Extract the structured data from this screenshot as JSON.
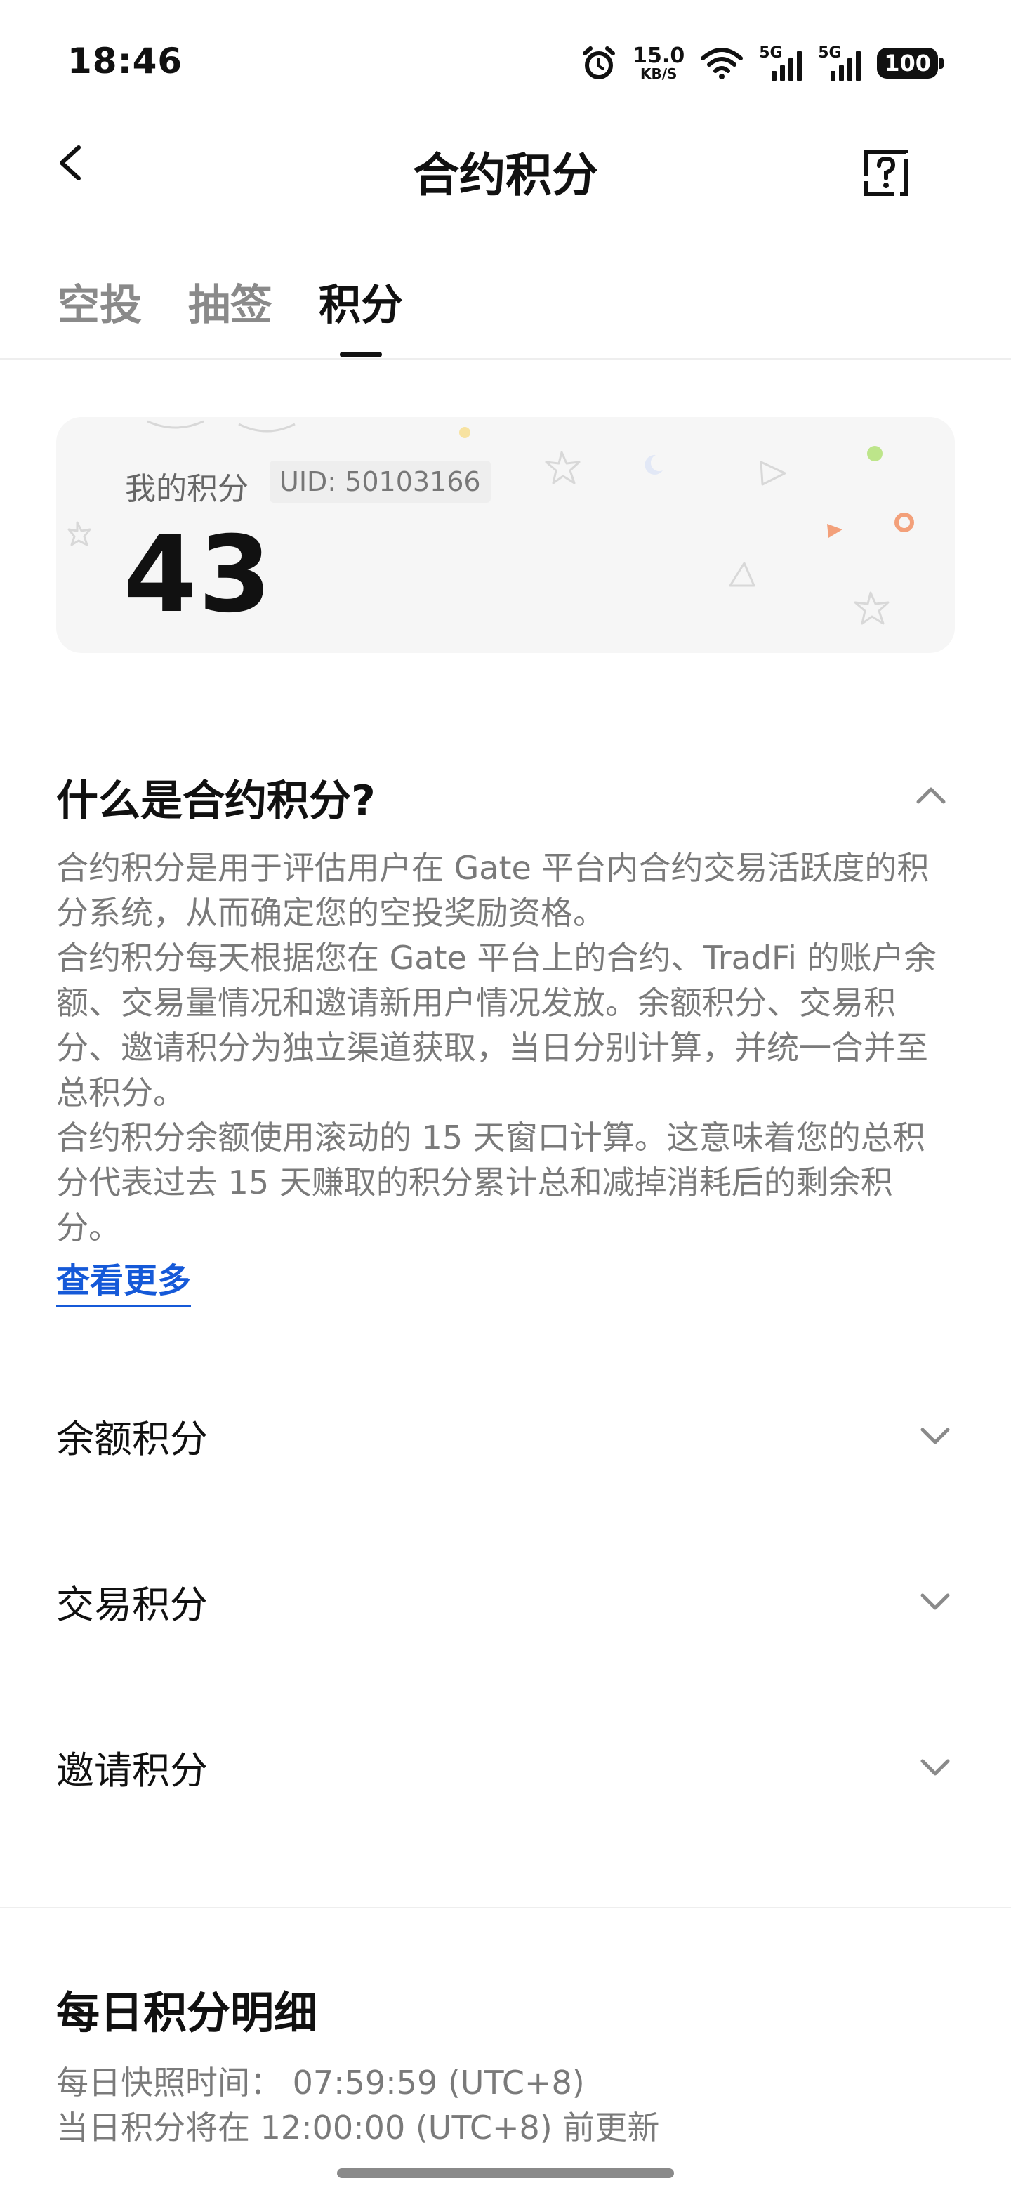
{
  "status_bar": {
    "time": "18:46",
    "net_speed_value": "15.0",
    "net_speed_unit": "KB/S",
    "sim1_label": "5G",
    "sim2_label": "5G",
    "battery": "100",
    "icons": [
      "alarm-icon",
      "wifi-icon",
      "signal-icon",
      "signal-icon",
      "battery-icon"
    ]
  },
  "header": {
    "title": "合约积分",
    "back_icon": "chevron-left-icon",
    "help_icon": "question-icon"
  },
  "tabs": [
    {
      "label": "空投",
      "active": false
    },
    {
      "label": "抽签",
      "active": false
    },
    {
      "label": "积分",
      "active": true
    }
  ],
  "points_card": {
    "label": "我的积分",
    "uid": "UID: 50103166",
    "value": "43"
  },
  "faq": {
    "title": "什么是合约积分?",
    "paragraphs": [
      "合约积分是用于评估用户在 Gate 平台内合约交易活跃度的积分系统，从而确定您的空投奖励资格。",
      "合约积分每天根据您在 Gate 平台上的合约、TradFi 的账户余额、交易量情况和邀请新用户情况发放。余额积分、交易积分、邀请积分为独立渠道获取，当日分别计算，并统一合并至总积分。",
      "合约积分余额使用滚动的 15 天窗口计算。这意味着您的总积分代表过去 15 天赚取的积分累计总和减掉消耗后的剩余积分。"
    ],
    "more_link": "查看更多"
  },
  "accordions": [
    {
      "label": "余额积分"
    },
    {
      "label": "交易积分"
    },
    {
      "label": "邀请积分"
    }
  ],
  "daily": {
    "title": "每日积分明细",
    "snapshot": "每日快照时间：  07:59:59 (UTC+8)",
    "update": "当日积分将在 12:00:00 (UTC+8) 前更新"
  },
  "colors": {
    "accent_link": "#1559d8",
    "card_bg": "#f6f6f6",
    "muted_text": "#7a7a7a"
  }
}
